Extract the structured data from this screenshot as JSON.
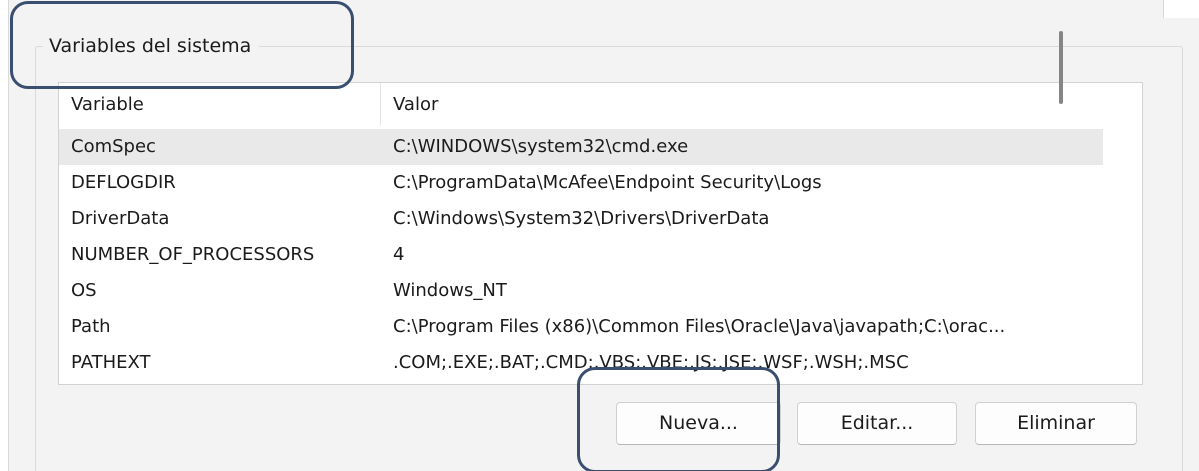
{
  "group": {
    "title": "Variables del sistema"
  },
  "list": {
    "columns": [
      "Variable",
      "Valor"
    ],
    "rows": [
      {
        "name": "ComSpec",
        "value": "C:\\WINDOWS\\system32\\cmd.exe"
      },
      {
        "name": "DEFLOGDIR",
        "value": "C:\\ProgramData\\McAfee\\Endpoint Security\\Logs"
      },
      {
        "name": "DriverData",
        "value": "C:\\Windows\\System32\\Drivers\\DriverData"
      },
      {
        "name": "NUMBER_OF_PROCESSORS",
        "value": "4"
      },
      {
        "name": "OS",
        "value": "Windows_NT"
      },
      {
        "name": "Path",
        "value": "C:\\Program Files (x86)\\Common Files\\Oracle\\Java\\javapath;C:\\orac..."
      },
      {
        "name": "PATHEXT",
        "value": ".COM;.EXE;.BAT;.CMD;.VBS;.VBE;.JS;.JSE;.WSF;.WSH;.MSC"
      }
    ],
    "selected_row": "ComSpec"
  },
  "buttons": {
    "new_label": "Nueva...",
    "edit_label": "Editar...",
    "delete_label": "Eliminar"
  },
  "colors": {
    "annotation": "#3a4f6f",
    "dialog_bg": "#f3f3f3",
    "selected_row_bg": "#e9e9e9"
  }
}
